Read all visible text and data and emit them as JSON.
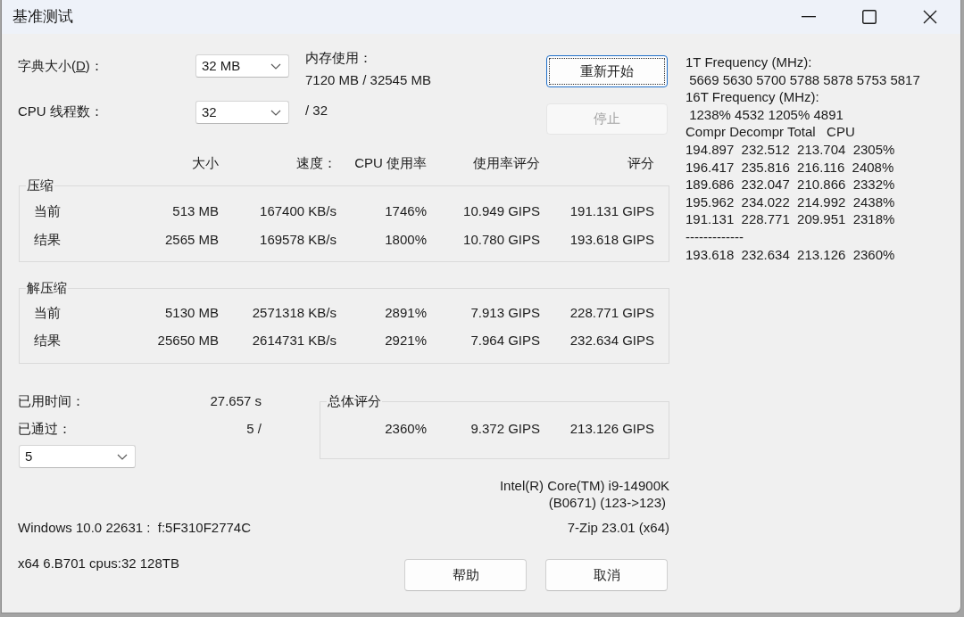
{
  "window": {
    "title": "基准测试"
  },
  "settings": {
    "dictionary": {
      "label_before": "字典大小(",
      "access_key": "D",
      "label_after": ")：",
      "value": "32 MB"
    },
    "memory": {
      "label": "内存使用：",
      "value": "7120 MB / 32545 MB"
    },
    "threads": {
      "label": "CPU 线程数：",
      "value": "32",
      "note": "/ 32"
    }
  },
  "actions": [
    {
      "label": "重新开始",
      "focused": true,
      "disabled": false
    },
    {
      "label": "停止",
      "focused": false,
      "disabled": true
    }
  ],
  "table": {
    "columns": [
      "大小",
      "速度：",
      "CPU 使用率",
      "使用率评分",
      "评分"
    ],
    "groups": [
      {
        "title": "压缩",
        "rows": [
          {
            "label": "当前",
            "cells": [
              "513 MB",
              "167400 KB/s",
              "1746%",
              "10.949 GIPS",
              "191.131 GIPS"
            ]
          },
          {
            "label": "结果",
            "cells": [
              "2565 MB",
              "169578 KB/s",
              "1800%",
              "10.780 GIPS",
              "193.618 GIPS"
            ]
          }
        ]
      },
      {
        "title": "解压缩",
        "rows": [
          {
            "label": "当前",
            "cells": [
              "5130 MB",
              "2571318 KB/s",
              "2891%",
              "7.913 GIPS",
              "228.771 GIPS"
            ]
          },
          {
            "label": "结果",
            "cells": [
              "25650 MB",
              "2614731 KB/s",
              "2921%",
              "7.964 GIPS",
              "232.634 GIPS"
            ]
          }
        ]
      }
    ]
  },
  "elapsed": {
    "label": "已用时间：",
    "value": "27.657 s"
  },
  "passes": {
    "label": "已通过：",
    "value": "5 /",
    "dropdown": "5"
  },
  "total": {
    "title": "总体评分",
    "cells": [
      "2360%",
      "9.372 GIPS",
      "213.126 GIPS"
    ]
  },
  "cpu_info": [
    "Intel(R) Core(TM) i9-14900K",
    "(B0671) (123->123)"
  ],
  "system": {
    "os": "Windows 10.0 22631 :  f:5F310F2774C",
    "version": "7-Zip 23.01 (x64)",
    "build": "x64 6.B701 cpus:32 128TB"
  },
  "footer_buttons": [
    {
      "label": "帮助"
    },
    {
      "label": "取消"
    }
  ],
  "log": [
    "1T Frequency (MHz):",
    " 5669 5630 5700 5788 5878 5753 5817",
    "16T Frequency (MHz):",
    " 1238% 4532 1205% 4891",
    "Compr Decompr Total   CPU",
    "194.897  232.512  213.704  2305%",
    "196.417  235.816  216.116  2408%",
    "189.686  232.047  210.866  2332%",
    "195.962  234.022  214.992  2438%",
    "191.131  228.771  209.951  2318%",
    "-------------",
    "193.618  232.634  213.126  2360%"
  ]
}
